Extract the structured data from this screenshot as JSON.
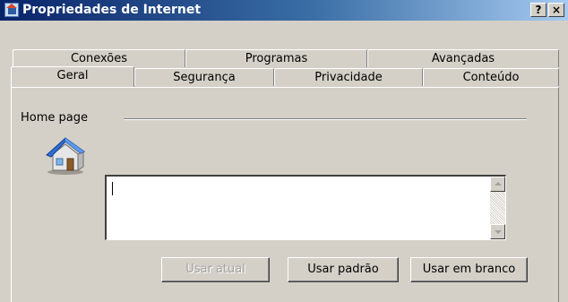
{
  "window": {
    "title": "Propriedades de Internet",
    "help_label": "?",
    "close_label": "×"
  },
  "tabs": {
    "back_row": [
      {
        "label": "Conexões"
      },
      {
        "label": "Programas"
      },
      {
        "label": "Avançadas"
      }
    ],
    "front_row": [
      {
        "label": "Geral",
        "selected": true
      },
      {
        "label": "Segurança"
      },
      {
        "label": "Privacidade"
      },
      {
        "label": "Conteúdo"
      }
    ]
  },
  "home_page": {
    "group_label": "Home page",
    "icon": "house-icon",
    "url_value": "",
    "buttons": {
      "current": {
        "label": "Usar atual",
        "enabled": false
      },
      "default": {
        "label": "Usar padrão",
        "enabled": true
      },
      "blank": {
        "label": "Usar em branco",
        "enabled": true
      }
    }
  },
  "colors": {
    "dialog_face": "#d4d0c8",
    "title_start": "#0a246a",
    "title_end": "#a6caf0"
  }
}
